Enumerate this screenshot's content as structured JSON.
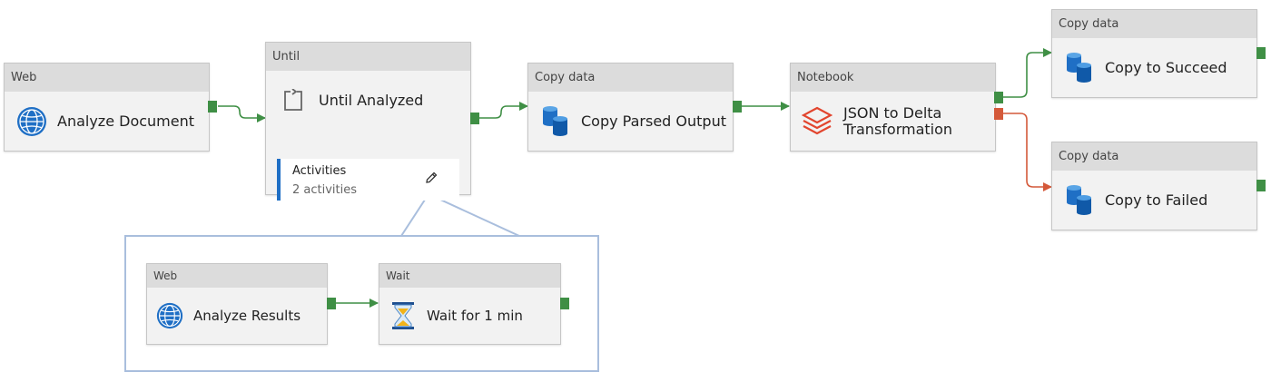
{
  "activities": {
    "analyze_document": {
      "type": "Web",
      "name": "Analyze Document"
    },
    "until_analyzed": {
      "type": "Until",
      "name": "Until Analyzed",
      "activities_label": "Activities",
      "activities_count": "2 activities"
    },
    "copy_parsed_output": {
      "type": "Copy data",
      "name": "Copy Parsed Output"
    },
    "json_to_delta": {
      "type": "Notebook",
      "name_line1": "JSON to Delta",
      "name_line2": "Transformation"
    },
    "copy_to_succeed": {
      "type": "Copy data",
      "name": "Copy to Succeed"
    },
    "copy_to_failed": {
      "type": "Copy data",
      "name": "Copy to Failed"
    },
    "analyze_results": {
      "type": "Web",
      "name": "Analyze Results"
    },
    "wait_1_min": {
      "type": "Wait",
      "name": "Wait for 1 min"
    }
  },
  "colors": {
    "success": "#3f8f45",
    "failure": "#d4593a",
    "header": "#dcdcdc",
    "card": "#f2f2f2",
    "panel_border": "#a9bedd",
    "accent": "#1f6fc5"
  },
  "icons": {
    "web": "globe-icon",
    "until": "loop-icon",
    "copy": "database-icon",
    "notebook": "databricks-icon",
    "wait": "hourglass-icon",
    "edit": "pencil-icon"
  }
}
